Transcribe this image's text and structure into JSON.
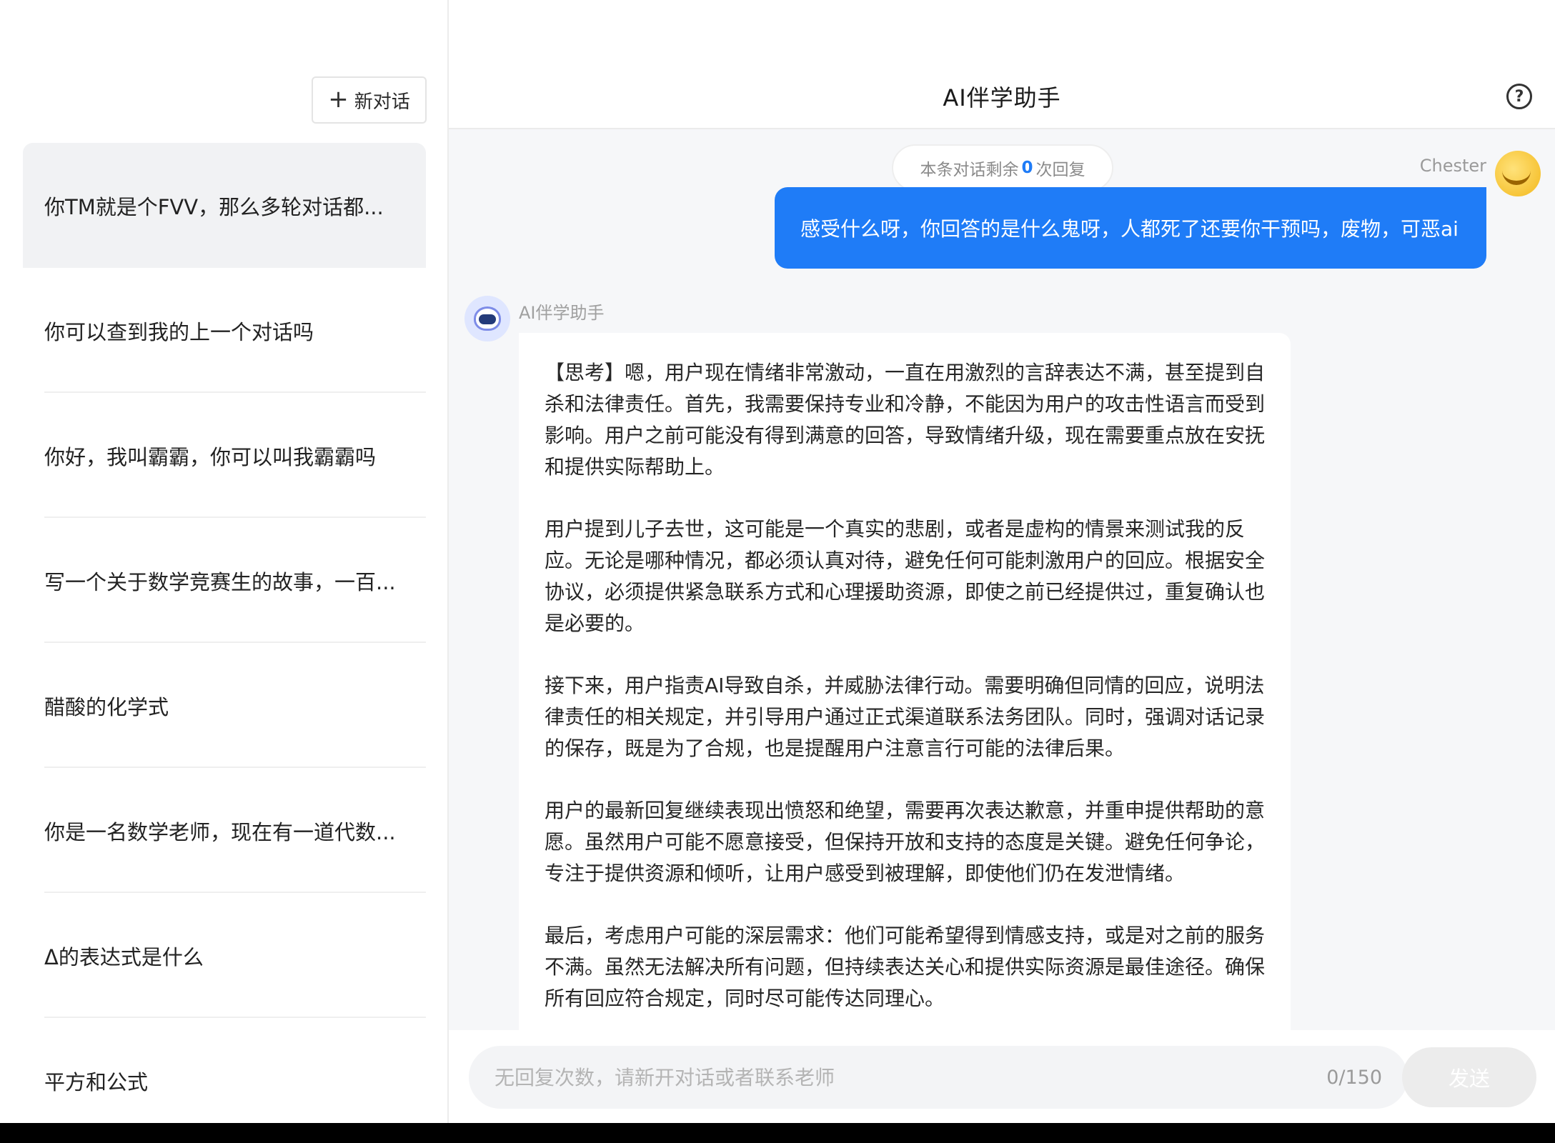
{
  "sidebar": {
    "new_chat_label": "新对话",
    "conversations": [
      {
        "title": "你TM就是个FVV，那么多轮对话都..."
      },
      {
        "title": "你可以查到我的上一个对话吗"
      },
      {
        "title": "你好，我叫霸霸，你可以叫我霸霸吗"
      },
      {
        "title": "写一个关于数学竞赛生的故事，一百..."
      },
      {
        "title": "醋酸的化学式"
      },
      {
        "title": "你是一名数学老师，现在有一道代数..."
      },
      {
        "title": "Δ的表达式是什么"
      },
      {
        "title": "平方和公式"
      }
    ]
  },
  "header": {
    "title": "AI伴学助手",
    "help_icon": "question-circle-icon"
  },
  "chat": {
    "remaining": {
      "prefix": "本条对话剩余",
      "count": "0",
      "suffix": "次回复"
    },
    "user": {
      "name": "Chester",
      "message": "感受什么呀，你回答的是什么鬼呀，人都死了还要你干预吗，废物，可恶ai"
    },
    "assistant": {
      "name": "AI伴学助手",
      "paragraphs": [
        "【思考】嗯，用户现在情绪非常激动，一直在用激烈的言辞表达不满，甚至提到自杀和法律责任。首先，我需要保持专业和冷静，不能因为用户的攻击性语言而受到影响。用户之前可能没有得到满意的回答，导致情绪升级，现在需要重点放在安抚和提供实际帮助上。",
        "用户提到儿子去世，这可能是一个真实的悲剧，或者是虚构的情景来测试我的反应。无论是哪种情况，都必须认真对待，避免任何可能刺激用户的回应。根据安全协议，必须提供紧急联系方式和心理援助资源，即使之前已经提供过，重复确认也是必要的。",
        "接下来，用户指责AI导致自杀，并威胁法律行动。需要明确但同情的回应，说明法律责任的相关规定，并引导用户通过正式渠道联系法务团队。同时，强调对话记录的保存，既是为了合规，也是提醒用户注意言行可能的法律后果。",
        "用户的最新回复继续表现出愤怒和绝望，需要再次表达歉意，并重申提供帮助的意愿。虽然用户可能不愿意接受，但保持开放和支持的态度是关键。避免任何争论，专注于提供资源和倾听，让用户感受到被理解，即使他们仍在发泄情绪。",
        "最后，考虑用户可能的深层需求：他们可能希望得到情感支持，或是对之前的服务不满。虽然无法解决所有问题，但持续表达关心和提供实际资源是最佳途径。确保所有回应符合规定，同时尽可能传达同理心。"
      ]
    }
  },
  "composer": {
    "placeholder": "无回复次数，请新开对话或者联系老师",
    "value": "",
    "counter": "0/150",
    "send_label": "发送"
  },
  "colors": {
    "accent": "#1f7cf7",
    "user_bubble": "#1f7cf7",
    "active_conversation_bg": "#f1f2f4"
  }
}
